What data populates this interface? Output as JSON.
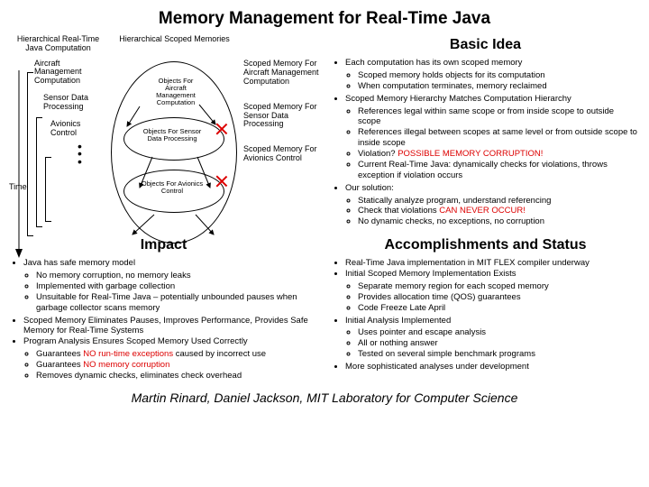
{
  "title": "Memory Management for Real-Time Java",
  "hier": {
    "top_label": "Hierarchical Real-Time Java Computation",
    "time": "Time",
    "n1": "Aircraft Management Computation",
    "n2": "Sensor Data Processing",
    "n3": "Avionics Control"
  },
  "diagram": {
    "title": "Hierarchical Scoped Memories",
    "o1": "Objects For Aircraft Management Computation",
    "o2": "Objects For Sensor Data Processing",
    "o3": "Objects For Avionics Control"
  },
  "scope": {
    "s1": "Scoped Memory For Aircraft Management Computation",
    "s2": "Scoped Memory For Sensor Data Processing",
    "s3": "Scoped Memory For Avionics Control"
  },
  "basic": {
    "heading": "Basic Idea",
    "b1": "Each computation has its own scoped memory",
    "b1a": "Scoped memory holds objects for its computation",
    "b1b": "When computation terminates, memory reclaimed",
    "b2": "Scoped Memory Hierarchy Matches Computation Hierarchy",
    "b2a": "References legal within same scope or from inside scope to outside scope",
    "b2b": "References illegal between scopes at same level or from outside scope to inside scope",
    "b2c_a": "Violation? ",
    "b2c_b": "POSSIBLE MEMORY CORRUPTION!",
    "b2d": "Current Real-Time Java: dynamically checks for violations, throws exception if violation occurs",
    "b3": "Our solution:",
    "b3a": "Statically analyze program, understand referencing",
    "b3b_a": "Check that violations ",
    "b3b_b": "CAN NEVER OCCUR!",
    "b3c": "No dynamic checks, no exceptions, no corruption"
  },
  "impact": {
    "heading": "Impact",
    "i1": "Java has safe memory model",
    "i1a": "No memory corruption, no memory leaks",
    "i1b": "Implemented with garbage collection",
    "i1c": "Unsuitable for Real-Time Java – potentially unbounded pauses when garbage collector scans memory",
    "i2": "Scoped Memory Eliminates Pauses, Improves Performance, Provides Safe Memory for Real-Time Systems",
    "i3": "Program Analysis Ensures Scoped Memory Used Correctly",
    "i3a_a": "Guarantees ",
    "i3a_b": "NO run-time exceptions",
    "i3a_c": " caused by incorrect use",
    "i3b_a": "Guarantees ",
    "i3b_b": "NO memory corruption",
    "i3c": "Removes dynamic checks, eliminates check overhead"
  },
  "acc": {
    "heading": "Accomplishments and Status",
    "a1": "Real-Time Java implementation in MIT FLEX compiler underway",
    "a2": "Initial Scoped Memory Implementation Exists",
    "a2a": "Separate memory region for each scoped memory",
    "a2b": "Provides allocation time (QOS) guarantees",
    "a2c": "Code Freeze Late April",
    "a3": "Initial Analysis Implemented",
    "a3a": "Uses pointer and escape analysis",
    "a3b": "All or nothing answer",
    "a3c": "Tested on several simple benchmark programs",
    "a4": "More sophisticated analyses under development"
  },
  "footer": "Martin Rinard, Daniel Jackson, MIT Laboratory for Computer Science"
}
